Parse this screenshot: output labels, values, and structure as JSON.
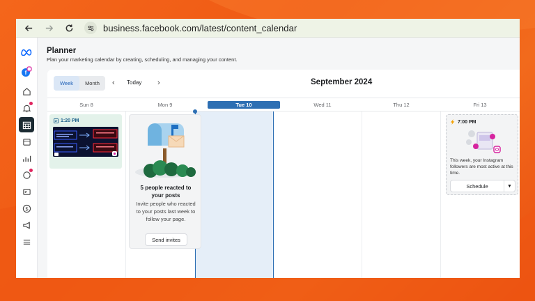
{
  "browser": {
    "url": "business.facebook.com/latest/content_calendar"
  },
  "rail": {
    "icons": [
      "meta-logo-icon",
      "profile-icon",
      "home-icon",
      "notifications-icon",
      "calendar-icon",
      "content-icon",
      "insights-icon",
      "messages-icon",
      "ads-icon",
      "monetization-icon",
      "megaphone-icon",
      "menu-icon"
    ],
    "accent": "#1c2b33"
  },
  "planner": {
    "title": "Planner",
    "subtitle": "Plan your marketing calendar by creating, scheduling, and managing your content."
  },
  "toolbar": {
    "week_label": "Week",
    "month_label": "Month",
    "today_label": "Today",
    "prev_icon": "chevron-left-icon",
    "next_icon": "chevron-right-icon",
    "month_title": "September 2024"
  },
  "days": [
    {
      "label": "Sun 8"
    },
    {
      "label": "Mon 9"
    },
    {
      "label": "Tue 10"
    },
    {
      "label": "Wed 11"
    },
    {
      "label": "Thu 12"
    },
    {
      "label": "Fri 13"
    }
  ],
  "post": {
    "time": "1:20 PM"
  },
  "reaction_card": {
    "title": "5 people reacted to your posts",
    "body": "Invite people who reacted to your posts last week to follow your page.",
    "button": "Send invites"
  },
  "insight_card": {
    "time": "7:00 PM",
    "text": "This week, your Instagram followers are most active at this time.",
    "button": "Schedule"
  },
  "colors": {
    "today": "#2d6fb3",
    "background": "#f4661b"
  }
}
